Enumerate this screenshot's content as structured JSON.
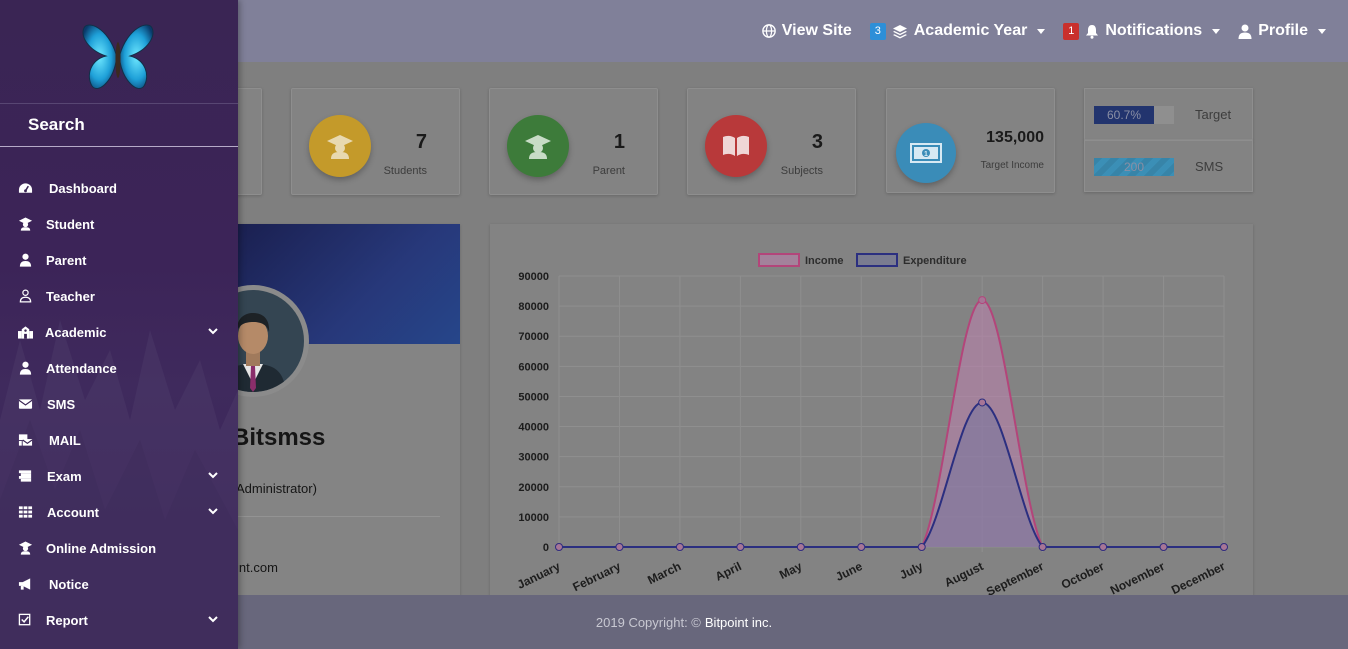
{
  "topbar": {
    "view_site": "View Site",
    "academic_badge": "3",
    "academic_year": "Academic Year",
    "notif_badge": "1",
    "notifications": "Notifications",
    "profile": "Profile"
  },
  "stats": [
    {
      "value": "7",
      "label": "Students",
      "color": "#c49a2a",
      "icon": "graduate-icon"
    },
    {
      "value": "1",
      "label": "Parent",
      "color": "#3d7b3a",
      "icon": "graduate-icon"
    },
    {
      "value": "3",
      "label": "Subjects",
      "color": "#b8393a",
      "icon": "book-icon"
    },
    {
      "value": "135,000",
      "label": "Target Income",
      "color": "#3a8cb8",
      "icon": "money-icon"
    }
  ],
  "mini": {
    "target": {
      "value": "60.7%",
      "label": "Target",
      "fraction": 0.75
    },
    "sms": {
      "value": "200",
      "label": "SMS",
      "fraction": 1.0
    }
  },
  "profile": {
    "name": "Bitsmss",
    "role": "Administrator)",
    "email": "int.com"
  },
  "chart_data": {
    "type": "line",
    "categories": [
      "January",
      "February",
      "March",
      "April",
      "May",
      "June",
      "July",
      "August",
      "September",
      "October",
      "November",
      "December"
    ],
    "series": [
      {
        "name": "Income",
        "values": [
          0,
          0,
          0,
          0,
          0,
          0,
          0,
          82000,
          0,
          0,
          0,
          0
        ],
        "color": "#b3457a"
      },
      {
        "name": "Expenditure",
        "values": [
          0,
          0,
          0,
          0,
          0,
          0,
          0,
          48000,
          0,
          0,
          0,
          0
        ],
        "color": "#2b2f80"
      }
    ],
    "yticks": [
      "90000",
      "80000",
      "70000",
      "60000",
      "50000",
      "40000",
      "30000",
      "20000",
      "10000",
      "0"
    ],
    "ylim": [
      0,
      90000
    ],
    "legend_position": "top",
    "grid": true
  },
  "footer": {
    "text": "2019 Copyright: ©",
    "brand": "Bitpoint inc."
  },
  "sidebar": {
    "search": "Search",
    "items": [
      {
        "label": "Dashboard",
        "icon": "dashboard-icon",
        "chevron": false
      },
      {
        "label": "Student",
        "icon": "graduate-icon",
        "chevron": false
      },
      {
        "label": "Parent",
        "icon": "user-icon",
        "chevron": false
      },
      {
        "label": "Teacher",
        "icon": "user-outline-icon",
        "chevron": false
      },
      {
        "label": "Academic",
        "icon": "school-icon",
        "chevron": true
      },
      {
        "label": "Attendance",
        "icon": "user-icon",
        "chevron": false
      },
      {
        "label": "SMS",
        "icon": "envelope-icon",
        "chevron": false
      },
      {
        "label": "MAIL",
        "icon": "mail-bulk-icon",
        "chevron": false
      },
      {
        "label": "Exam",
        "icon": "scroll-icon",
        "chevron": true
      },
      {
        "label": "Account",
        "icon": "grid-icon",
        "chevron": true
      },
      {
        "label": "Online Admission",
        "icon": "graduate-icon",
        "chevron": false
      },
      {
        "label": "Notice",
        "icon": "bullhorn-icon",
        "chevron": false
      },
      {
        "label": "Report",
        "icon": "check-square-icon",
        "chevron": true
      }
    ]
  }
}
